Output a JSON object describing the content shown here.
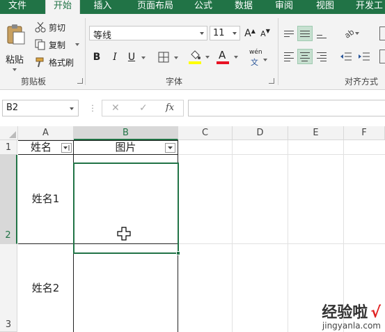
{
  "tabs": [
    {
      "label": "文件",
      "active": false
    },
    {
      "label": "开始",
      "active": true
    },
    {
      "label": "插入",
      "active": false
    },
    {
      "label": "页面布局",
      "active": false
    },
    {
      "label": "公式",
      "active": false
    },
    {
      "label": "数据",
      "active": false
    },
    {
      "label": "审阅",
      "active": false
    },
    {
      "label": "视图",
      "active": false
    },
    {
      "label": "开发工",
      "active": false
    }
  ],
  "ribbon": {
    "clipboard": {
      "paste_label": "粘贴",
      "cut_label": "剪切",
      "copy_label": "复制",
      "format_painter_label": "格式刷",
      "group_label": "剪贴板"
    },
    "font": {
      "font_name": "等线",
      "font_size": "11",
      "bold": "B",
      "italic": "I",
      "underline": "U",
      "font_color_glyph": "A",
      "phonetic_top": "wén",
      "phonetic_bottom": "文",
      "grow_glyph": "A",
      "shrink_glyph": "A",
      "group_label": "字体"
    },
    "alignment": {
      "group_label": "对齐方式",
      "orientation_glyph": "ab"
    }
  },
  "formula_bar": {
    "name_box": "B2",
    "cancel_glyph": "✕",
    "enter_glyph": "✓",
    "fx_label": "fx",
    "formula": ""
  },
  "sheet": {
    "columns": [
      "A",
      "B",
      "C",
      "D",
      "E",
      "F"
    ],
    "selected_column": "B",
    "rows": [
      "1",
      "2",
      "3"
    ],
    "selected_row": "2",
    "active_cell": "B2",
    "cells": {
      "A1": "姓名",
      "B1": "图片",
      "A2": "姓名1",
      "A3": "姓名2"
    }
  },
  "watermark": {
    "title": "经验啦",
    "check": "√",
    "url": "jingyanla.com"
  },
  "colors": {
    "accent": "#217346",
    "selected_fill": "#c7e0d0",
    "font_color": "#e81123",
    "highlight": "#ffff00"
  }
}
